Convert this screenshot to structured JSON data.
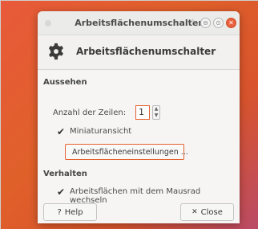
{
  "window": {
    "title": "Arbeitsflächenumschalter",
    "controls": [
      "✧",
      "⊖",
      "⊙",
      "✕"
    ]
  },
  "header": {
    "title": "Arbeitsflächenumschalter"
  },
  "appearance": {
    "section": "Aussehen",
    "rows_label": "Anzahl der Zeilen:",
    "rows_value": "1",
    "thumbnail_label": "Miniaturansicht",
    "thumbnail_checked": true,
    "settings_button": "Arbeitsflächeneinstellungen ..."
  },
  "behavior": {
    "section": "Verhalten",
    "wheel_label": "Arbeitsflächen mit dem Mausrad wechseln",
    "wheel_checked": true
  },
  "footer": {
    "help_icon": "?",
    "help_label": "Help",
    "close_icon": "✕",
    "close_label": "Close"
  },
  "colors": {
    "accent": "#e6612f",
    "close_button": "#e9603c",
    "settings_icon": "#2a8bd6"
  }
}
